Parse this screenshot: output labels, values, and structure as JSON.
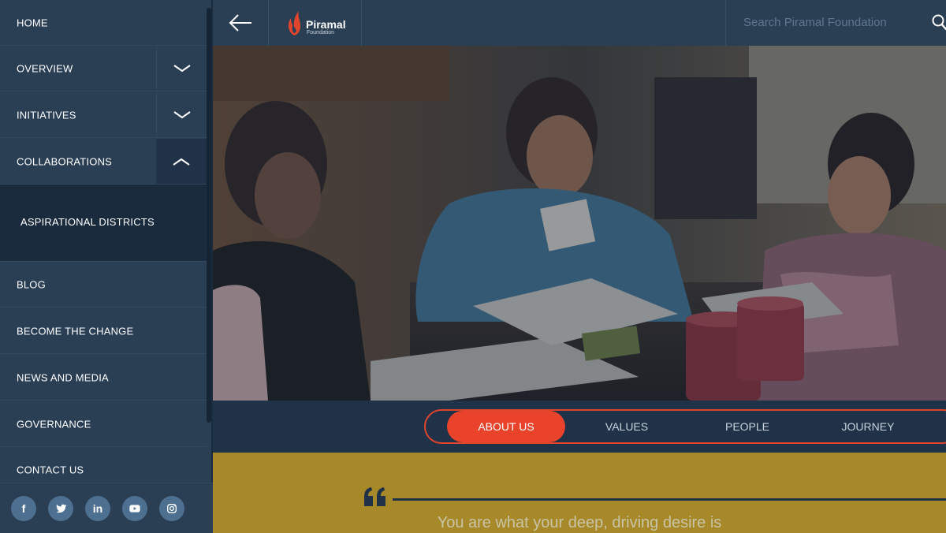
{
  "sidebar": {
    "items": [
      {
        "label": "HOME"
      },
      {
        "label": "OVERVIEW"
      },
      {
        "label": "INITIATIVES"
      },
      {
        "label": "COLLABORATIONS"
      },
      {
        "label": "BLOG"
      },
      {
        "label": "BECOME THE CHANGE"
      },
      {
        "label": "NEWS AND MEDIA"
      },
      {
        "label": "GOVERNANCE"
      },
      {
        "label": "CONTACT US"
      }
    ],
    "submenu": {
      "label": "ASPIRATIONAL DISTRICTS"
    },
    "social": [
      {
        "icon": "facebook-icon",
        "glyph": "f"
      },
      {
        "icon": "twitter-icon"
      },
      {
        "icon": "linkedin-icon",
        "glyph": "in"
      },
      {
        "icon": "youtube-icon"
      },
      {
        "icon": "instagram-icon"
      }
    ]
  },
  "header": {
    "logo_name": "Piramal",
    "logo_sub": "Foundation",
    "search_placeholder": "Search Piramal Foundation"
  },
  "tabs": [
    {
      "label": "ABOUT US",
      "active": true
    },
    {
      "label": "VALUES"
    },
    {
      "label": "PEOPLE"
    },
    {
      "label": "JOURNEY"
    }
  ],
  "quote": {
    "text": "You are what your deep, driving desire is"
  },
  "colors": {
    "sidebar_bg": "#2a3e54",
    "page_bg": "#1f3247",
    "accent": "#e9442b",
    "quote_bg": "#a88929"
  }
}
